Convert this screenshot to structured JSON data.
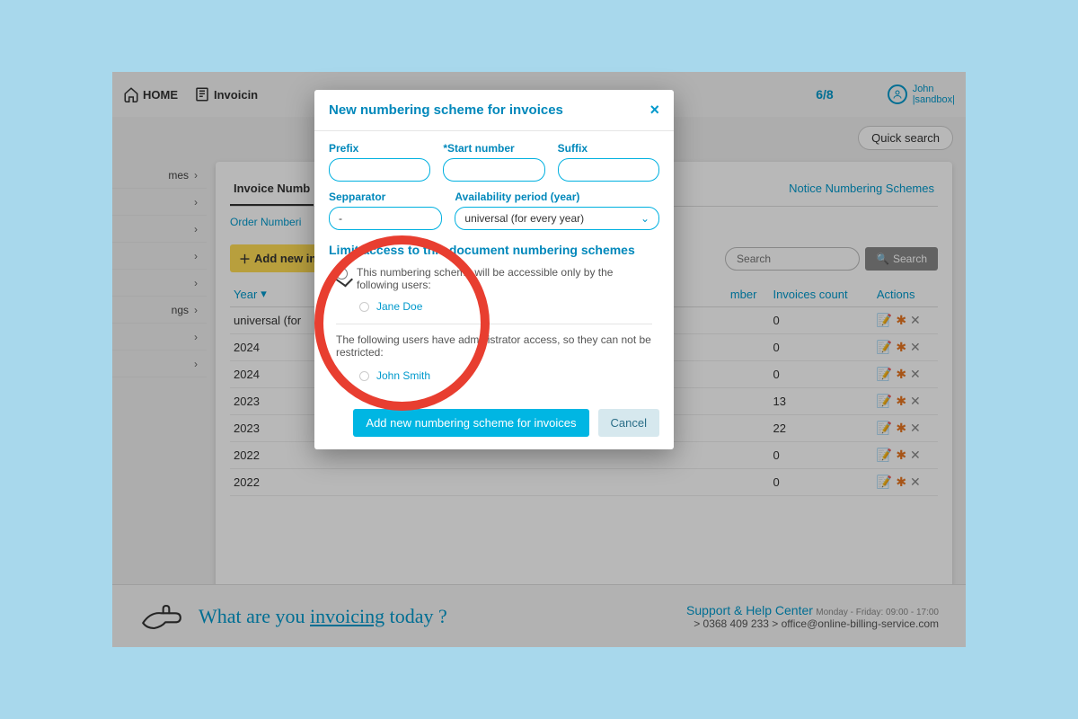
{
  "topbar": {
    "home_label": "HOME",
    "invoicing_label": "Invoicin",
    "counter_current": "6",
    "counter_total": "8",
    "user_name": "John",
    "user_sandbox": "|sandbox|"
  },
  "quick_search_label": "Quick search",
  "sidebar": {
    "items": [
      "mes",
      "",
      "",
      "",
      "",
      "ngs",
      "",
      ""
    ]
  },
  "main": {
    "tabs": [
      "Invoice Numb",
      "Notice Numbering Schemes"
    ],
    "active_tab": 0,
    "subtabs": [
      "Order Numberi"
    ],
    "add_button_label": "Add new in",
    "search_placeholder": "Search",
    "search_button": "Search",
    "columns": [
      "Year",
      "mber",
      "Invoices count",
      "Actions"
    ],
    "rows": [
      {
        "year": "universal (for",
        "mber": "",
        "count": "0"
      },
      {
        "year": "2024",
        "mber": "",
        "count": "0"
      },
      {
        "year": "2024",
        "mber": "",
        "count": "0"
      },
      {
        "year": "2023",
        "mber": "",
        "count": "13"
      },
      {
        "year": "2023",
        "mber": "",
        "count": "22"
      },
      {
        "year": "2022",
        "mber": "",
        "count": "0"
      },
      {
        "year": "2022",
        "mber": "",
        "count": "0"
      }
    ]
  },
  "modal": {
    "title": "New numbering scheme for invoices",
    "fields": {
      "prefix_label": "Prefix",
      "start_number_label": "*Start number",
      "suffix_label": "Suffix",
      "separator_label": "Sepparator",
      "separator_value": "-",
      "availability_label": "Availability period (year)",
      "availability_value": "universal (for every year)"
    },
    "section_title": "Limit access to this document numbering schemes",
    "access_text": "This numbering scheme will be accessible only by the following users:",
    "user_option": "Jane Doe",
    "admin_text": "The following users have administrator access, so they can not be restricted:",
    "admin_user": "John Smith",
    "primary_button": "Add new numbering scheme for invoices",
    "cancel_button": "Cancel"
  },
  "footer": {
    "tagline_pre": "What are you ",
    "tagline_underline": "invoicing",
    "tagline_post": " today ?",
    "support_title": "Support & Help Center",
    "support_hours": "Monday - Friday: 09:00 - 17:00",
    "phone": "> 0368 409 233",
    "email": "> office@online-billing-service.com"
  }
}
